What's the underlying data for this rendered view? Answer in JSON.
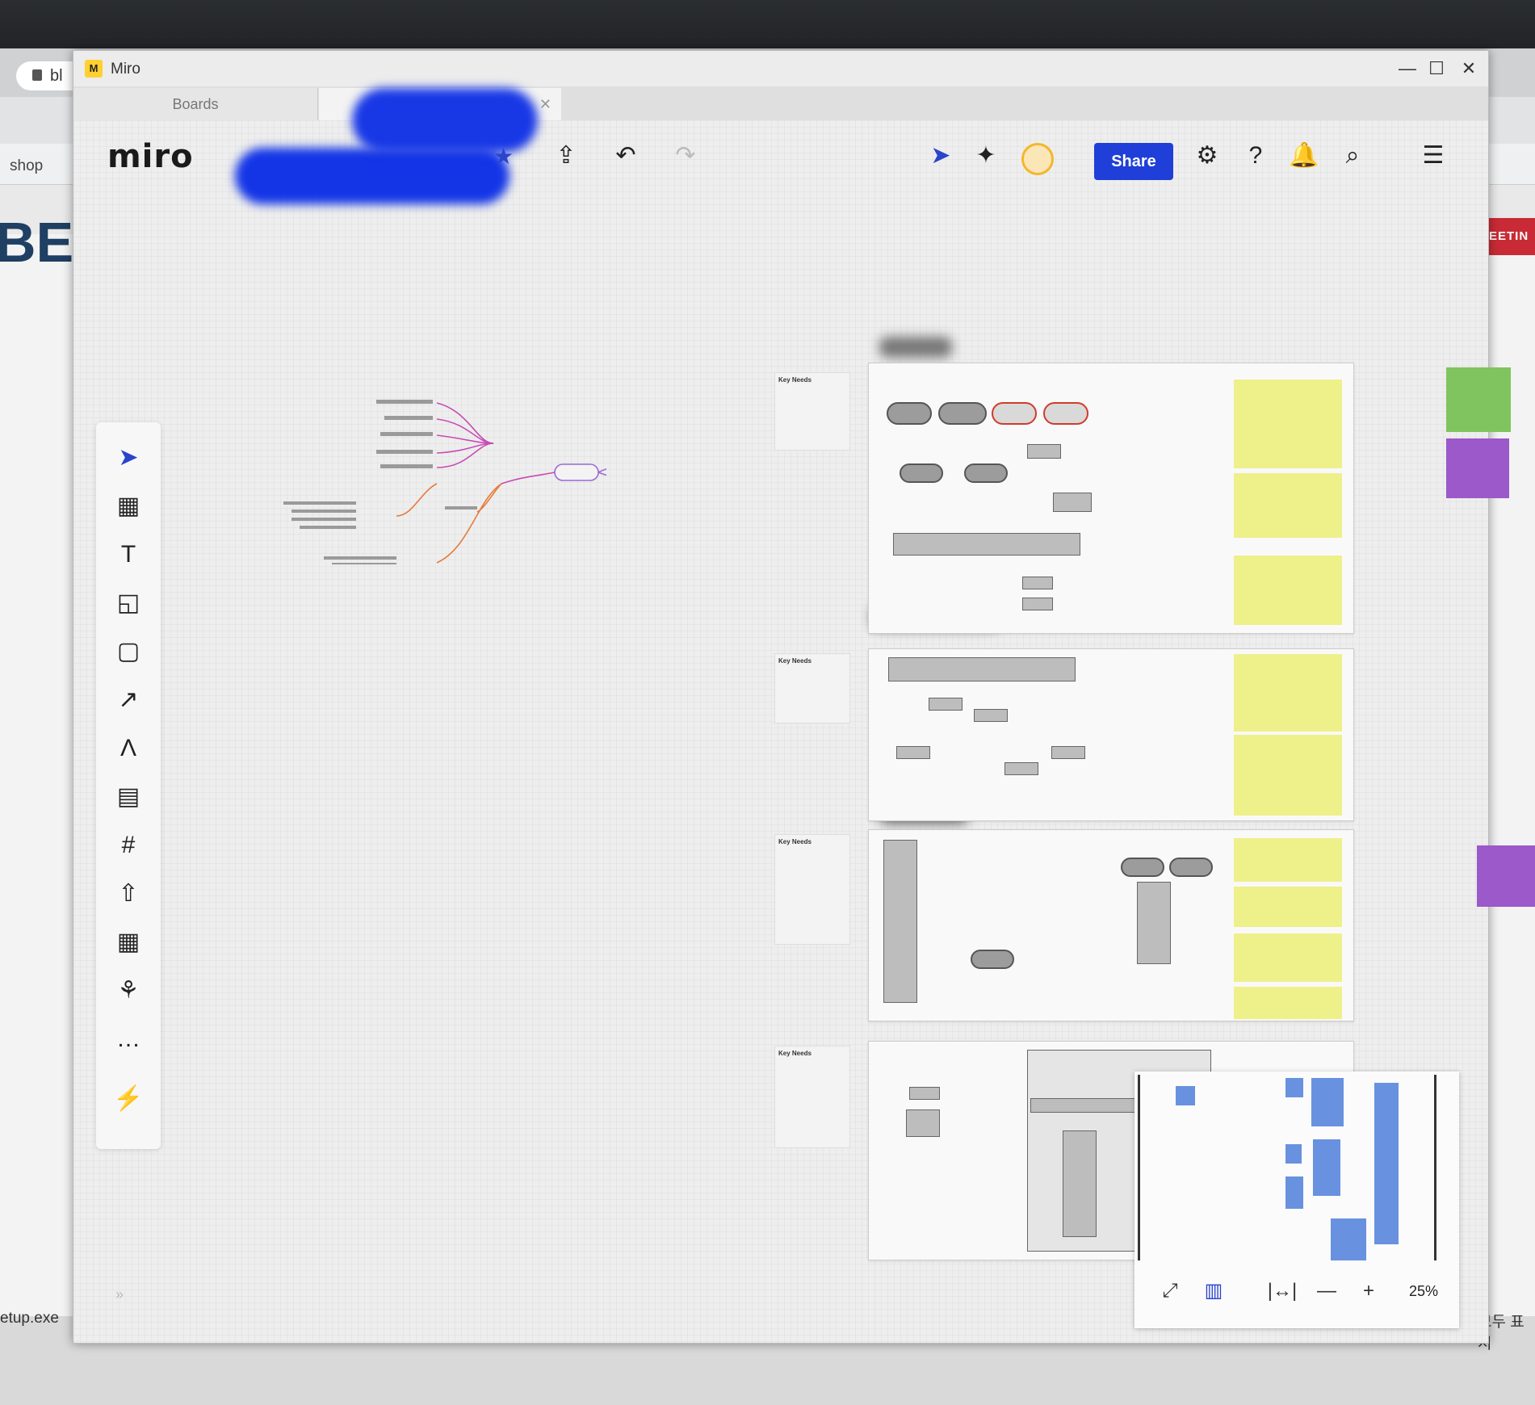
{
  "background_browser": {
    "url_fragment": "bl",
    "bookmark_label": "shop",
    "page_heading_fragment": "BE",
    "red_banner_fragment": "EETIN",
    "download_file": "etup.exe",
    "show_all_fragment": "모두 표시"
  },
  "window": {
    "title": "Miro",
    "controls": {
      "minimize": "—",
      "maximize": "☐",
      "close": "✕"
    }
  },
  "tabs": [
    {
      "label": "Boards",
      "active": false
    },
    {
      "label": "",
      "active": true,
      "close": "✕"
    }
  ],
  "topbar": {
    "logo": "miro",
    "share_label": "Share",
    "icons": [
      "star-icon",
      "upload-icon",
      "undo-icon",
      "redo-icon",
      "reactions-icon",
      "celebrate-icon",
      "avatar",
      "settings-icon",
      "help-icon",
      "notifications-icon",
      "search-icon",
      "board-menu-icon"
    ]
  },
  "toolbar": {
    "tools": [
      "select-icon",
      "templates-icon",
      "text-icon",
      "sticky-note-icon",
      "shape-icon",
      "arrow-icon",
      "pen-icon",
      "comment-icon",
      "frame-icon",
      "upload-icon",
      "table-icon",
      "more-apps-icon",
      "more-icon",
      "plugin-icon"
    ],
    "expand_label": "»"
  },
  "board": {
    "key_needs_title": "Key Needs",
    "colors": {
      "yellow_note": "#eef08a",
      "green_note": "#7fc45e",
      "purple_note": "#9b59c9",
      "accent": "#1f3fd8"
    }
  },
  "minimap": {
    "zoom": "25%",
    "controls": {
      "fit": "⤢",
      "map": "▥",
      "fit_width": "|↔|",
      "zoom_out": "—",
      "zoom_in": "+"
    }
  }
}
